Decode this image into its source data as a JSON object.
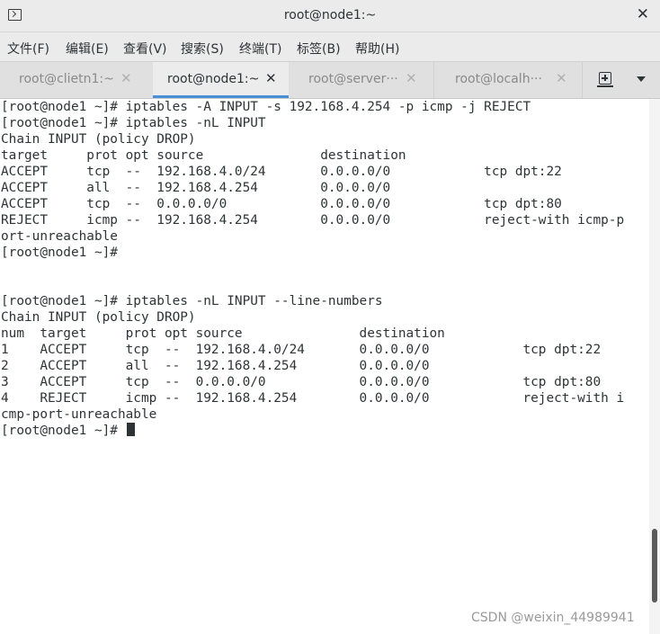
{
  "window": {
    "title": "root@node1:~",
    "close_glyph": "✕"
  },
  "menu": [
    {
      "label": "文件(F)"
    },
    {
      "label": "编辑(E)"
    },
    {
      "label": "查看(V)"
    },
    {
      "label": "搜索(S)"
    },
    {
      "label": "终端(T)"
    },
    {
      "label": "标签(B)"
    },
    {
      "label": "帮助(H)"
    }
  ],
  "tabs": [
    {
      "label": "root@clietn1:~",
      "close": "✕",
      "active": false
    },
    {
      "label": "root@node1:~",
      "close": "✕",
      "active": true
    },
    {
      "label": "root@server···",
      "close": "✕",
      "active": false
    },
    {
      "label": "root@localh···",
      "close": "✕",
      "active": false
    }
  ],
  "tab_actions": {
    "new_tab_icon": "new-tab-icon",
    "menu_icon": "chevron-down-icon"
  },
  "terminal": {
    "lines": [
      "[root@node1 ~]# iptables -A INPUT -s 192.168.4.254 -p icmp -j REJECT",
      "[root@node1 ~]# iptables -nL INPUT",
      "Chain INPUT (policy DROP)",
      "target     prot opt source               destination",
      "ACCEPT     tcp  --  192.168.4.0/24       0.0.0.0/0            tcp dpt:22",
      "ACCEPT     all  --  192.168.4.254        0.0.0.0/0",
      "ACCEPT     tcp  --  0.0.0.0/0            0.0.0.0/0            tcp dpt:80",
      "REJECT     icmp --  192.168.4.254        0.0.0.0/0            reject-with icmp-p",
      "ort-unreachable",
      "[root@node1 ~]#",
      "",
      "",
      "[root@node1 ~]# iptables -nL INPUT --line-numbers",
      "Chain INPUT (policy DROP)",
      "num  target     prot opt source               destination",
      "1    ACCEPT     tcp  --  192.168.4.0/24       0.0.0.0/0            tcp dpt:22",
      "2    ACCEPT     all  --  192.168.4.254        0.0.0.0/0",
      "3    ACCEPT     tcp  --  0.0.0.0/0            0.0.0.0/0            tcp dpt:80",
      "4    REJECT     icmp --  192.168.4.254        0.0.0.0/0            reject-with i",
      "cmp-port-unreachable",
      "[root@node1 ~]# "
    ]
  },
  "watermark": "CSDN @weixin_44989941",
  "colors": {
    "tab_active_underline": "#4a90d9",
    "text": "#2e3436",
    "chrome_bg": "#ebebeb"
  }
}
